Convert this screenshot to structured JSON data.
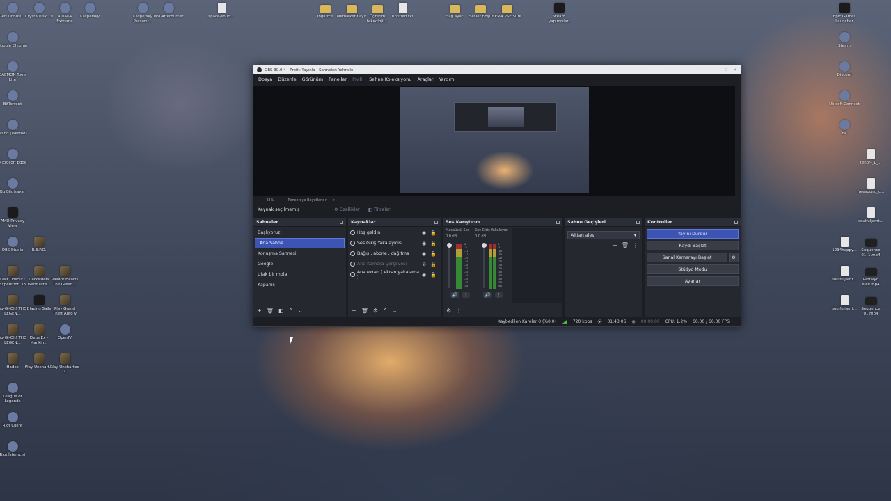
{
  "desktop": {
    "left_icons": [
      {
        "label": "Geri Dönüşü...",
        "icon": "recycle-bin-icon"
      },
      {
        "label": "CrystalDisk...9",
        "icon": "crystaldisk-icon"
      },
      {
        "label": "AIDA64 Extreme",
        "icon": "aida64-icon"
      },
      {
        "label": "Kaspersky",
        "icon": "kaspersky-icon"
      },
      {
        "label": "Kaspersky Passwor...",
        "icon": "kaspersky-password-icon"
      },
      {
        "label": "MSI Afterburner",
        "icon": "msi-afterburner-icon"
      },
      {
        "label": "space-shutt...",
        "icon": "image-file-icon"
      },
      {
        "label": "Google Chrome",
        "icon": "chrome-icon"
      },
      {
        "label": "DAEMON Tools Lite",
        "icon": "daemon-tools-icon"
      },
      {
        "label": "BitTorrent",
        "icon": "bittorrent-icon"
      },
      {
        "label": "Wand (WeMod)",
        "icon": "wand-icon"
      },
      {
        "label": "Microsoft Edge",
        "icon": "edge-icon"
      },
      {
        "label": "Bu Bilgisayar",
        "icon": "this-pc-icon"
      },
      {
        "label": "AMD Privacy View",
        "icon": "amd-icon"
      },
      {
        "label": "OBS Studio",
        "icon": "obs-icon"
      },
      {
        "label": "R.E.P.O.",
        "icon": "repo-game-icon"
      },
      {
        "label": "Clair Obscur : Expedition 33",
        "icon": "game-icon"
      },
      {
        "label": "Darksiders Warmaste...",
        "icon": "game-icon"
      },
      {
        "label": "Valiant Hearts The Great ...",
        "icon": "game-icon"
      },
      {
        "label": "Yu-Gi-Oh! THE LEGEN...",
        "icon": "game-icon"
      },
      {
        "label": "Blazing Sails",
        "icon": "epic-icon"
      },
      {
        "label": "Play Grand Theft Auto V",
        "icon": "game-icon"
      },
      {
        "label": "Yu-Gi-Oh! THE LEGEN...",
        "icon": "game-icon"
      },
      {
        "label": "Deus Ex - Mankin...",
        "icon": "game-icon"
      },
      {
        "label": "OpenIV",
        "icon": "openiv-icon"
      },
      {
        "label": "Hades",
        "icon": "game-icon"
      },
      {
        "label": "Play Unchart...",
        "icon": "game-icon"
      },
      {
        "label": "Play Uncharted 4",
        "icon": "game-icon"
      },
      {
        "label": "League of Legends",
        "icon": "league-icon"
      },
      {
        "label": "Riot Client",
        "icon": "riot-icon"
      },
      {
        "label": "Riot İstemcisi",
        "icon": "riot-icon"
      }
    ],
    "top_icons": [
      {
        "label": "ingilizce",
        "icon": "folder-icon"
      },
      {
        "label": "Memleket Kayıt",
        "icon": "folder-icon"
      },
      {
        "label": "Öğretim teknolojil...",
        "icon": "folder-icon"
      },
      {
        "label": "Untitled.txt",
        "icon": "text-file-icon"
      },
      {
        "label": "Sağ ayar",
        "icon": "folder-icon"
      },
      {
        "label": "Sesler Boşu",
        "icon": "folder-icon"
      },
      {
        "label": "BEMA PSE Süre",
        "icon": "folder-icon"
      },
      {
        "label": "Steam yapımcıları",
        "icon": "shortcut-icon"
      }
    ],
    "right_icons": [
      {
        "label": "Epic Games Launcher",
        "icon": "epic-icon"
      },
      {
        "label": "Steam",
        "icon": "steam-icon"
      },
      {
        "label": "Discord",
        "icon": "discord-icon"
      },
      {
        "label": "Ubisoft Connect",
        "icon": "ubisoft-icon"
      },
      {
        "label": "EA",
        "icon": "ea-icon"
      },
      {
        "label": "tenor-_1_...",
        "icon": "image-file-icon"
      },
      {
        "label": "freesound_c...",
        "icon": "audio-file-icon"
      },
      {
        "label": "soulfuljamt...",
        "icon": "audio-file-icon"
      },
      {
        "label": "1234happy...",
        "icon": "audio-file-icon"
      },
      {
        "label": "Sequence 01_1.mp4",
        "icon": "video-file-icon"
      },
      {
        "label": "soulfuljamt...",
        "icon": "audio-file-icon"
      },
      {
        "label": "Pattaiyo elev.mp4",
        "icon": "video-file-icon"
      },
      {
        "label": "soulfuljamt...",
        "icon": "audio-file-icon"
      },
      {
        "label": "Sequence 01.mp4",
        "icon": "video-file-icon"
      }
    ]
  },
  "obs": {
    "title": "OBS 30.0.4 - Profil: Yayınla - Sahneler: Yahnele",
    "menu": [
      "Dosya",
      "Düzenle",
      "Görünüm",
      "Paneller",
      "Profil",
      "Sahne Koleksiyonu",
      "Araçlar",
      "Yardım"
    ],
    "zoom": {
      "minus": "−",
      "value": "42%",
      "plus": "+",
      "fit": "Pencereye Boyutlandır"
    },
    "source_bar": {
      "none_selected": "Kaynak seçilmemiş",
      "properties": "Özellikler",
      "filters": "Filtreler"
    },
    "scenes": {
      "title": "Sahneler",
      "items": [
        "Başlıyoruz",
        "Ana Sahne",
        "Konuşma Sahnesi",
        "Google",
        "Ufak bir mola",
        "Kapanış"
      ],
      "selected_index": 1
    },
    "sources": {
      "title": "Kaynaklar",
      "items": [
        {
          "label": "Hoş geldin",
          "icon": "globe-icon",
          "visible": true
        },
        {
          "label": "Ses Giriş Yakalayıcısı",
          "icon": "microphone-icon",
          "visible": true
        },
        {
          "label": "Bağış , abone , dağıtma",
          "icon": "globe-icon",
          "visible": true
        },
        {
          "label": "Ana Kamera Çerçevesi",
          "icon": "globe-icon",
          "visible": false
        },
        {
          "label": "Ana ekran ( ekran yakalama )",
          "icon": "monitor-icon",
          "visible": true
        }
      ]
    },
    "mixer": {
      "title": "Ses Karıştırıcı",
      "channels": [
        {
          "name": "Masaüstü Ses",
          "db": "0.0 dB"
        },
        {
          "name": "Ses Giriş Yakalayıcı",
          "db": "0.0 dB"
        }
      ],
      "scale": [
        "0",
        "-5",
        "-10",
        "-15",
        "-20",
        "-25",
        "-30",
        "-35",
        "-40",
        "-45",
        "-50",
        "-55",
        "-60"
      ]
    },
    "transitions": {
      "title": "Sahne Geçişleri",
      "selected": "Alttan alev"
    },
    "controls": {
      "title": "Kontroller",
      "stop_stream": "Yayını Durdur",
      "start_recording": "Kaydı Başlat",
      "virtual_camera": "Sanal Kamerayı Başlat",
      "studio_mode": "Stüdyo Modu",
      "settings": "Ayarlar"
    },
    "status": {
      "dropped_frames": "Kaybedilen Kareler 0 (%0.0)",
      "bitrate": "720 kbps",
      "stream_time": "01:43:06",
      "rec_time": "00:00:00",
      "cpu": "CPU: 1.2%",
      "fps": "60.00 / 60.00 FPS"
    }
  }
}
